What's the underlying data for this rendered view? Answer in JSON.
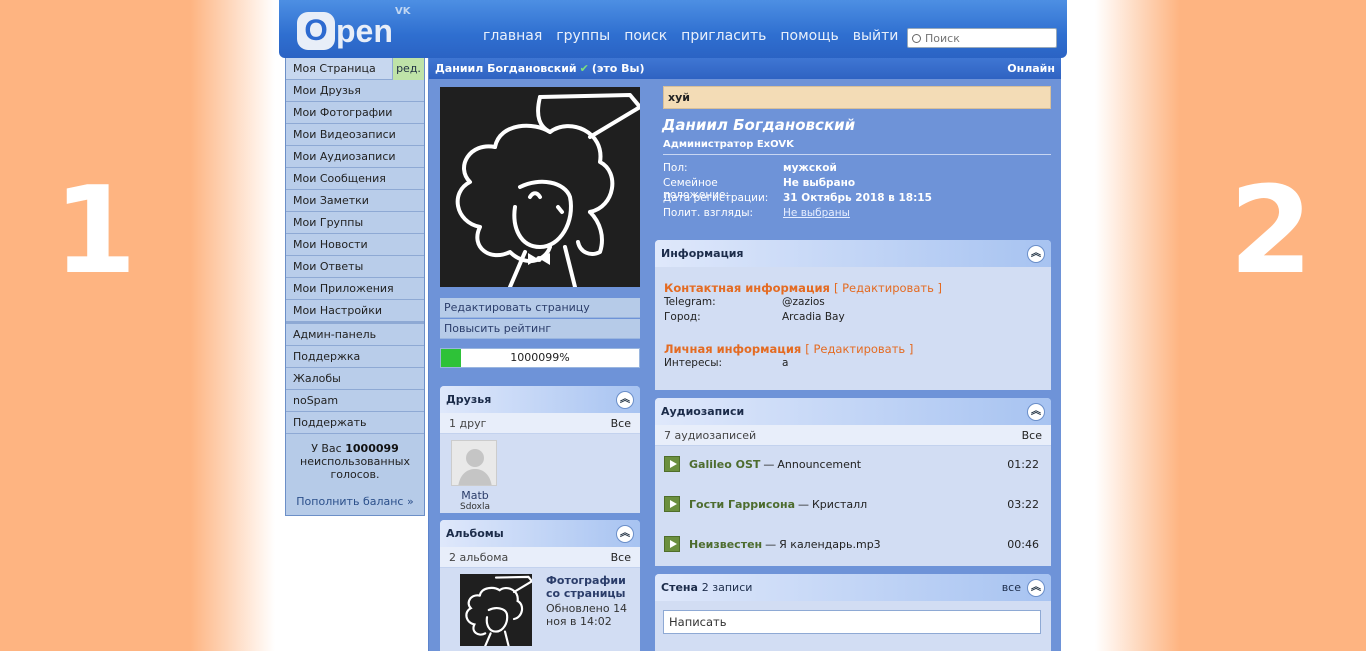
{
  "side_numbers": {
    "left": "1",
    "right": "2"
  },
  "header": {
    "logo_letter": "O",
    "logo_rest": "pen",
    "logo_sup": "VK",
    "nav": [
      "главная",
      "группы",
      "поиск",
      "пригласить",
      "помощь",
      "выйти"
    ],
    "search_placeholder": "Поиск"
  },
  "leftmenu": {
    "items": [
      "Моя Страница",
      "Мои Друзья",
      "Мои Фотографии",
      "Мои Видеозаписи",
      "Мои Аудиозаписи",
      "Мои Сообщения",
      "Мои Заметки",
      "Мои Группы",
      "Мои Новости",
      "Мои Ответы",
      "Мои Приложения",
      "Мои Настройки"
    ],
    "edit_label": "ред.",
    "admin_items": [
      "Админ-панель",
      "Поддержка",
      "Жалобы",
      "noSpam",
      "Поддержать"
    ],
    "votes_prefix": "У Вас",
    "votes_count": "1000099",
    "votes_suffix": "неиспользованных голосов.",
    "topup": "Пополнить баланс »"
  },
  "profile": {
    "title_name": "Даниил Богдановский",
    "title_you": "(это Вы)",
    "online": "Онлайн",
    "edit_page": "Редактировать страницу",
    "boost_rating": "Повысить рейтинг",
    "rating_text": "1000099%",
    "rating_fill": 0.1,
    "status": "хуй",
    "name": "Даниил Богдановский",
    "role": "Администратор ExOVK",
    "fields": [
      {
        "k": "Пол:",
        "v": "мужской"
      },
      {
        "k": "Семейное положение:",
        "v": "Не выбрано"
      },
      {
        "k": "Дата регистрации:",
        "v": "31 Октябрь 2018 в 18:15"
      },
      {
        "k": "Полит. взгляды:",
        "v": "Не выбраны"
      }
    ]
  },
  "friends": {
    "title": "Друзья",
    "count": "1 друг",
    "all": "Все",
    "items": [
      {
        "name": "Matb",
        "sub": "Sdoxla"
      }
    ]
  },
  "albums": {
    "title": "Альбомы",
    "count": "2 альбома",
    "all": "Все",
    "items": [
      {
        "title": "Фотографии со страницы",
        "date": "Обновлено 14 ноя в 14:02"
      }
    ]
  },
  "info": {
    "title": "Информация",
    "contact_title": "Контактная информация",
    "edit": "[ Редактировать ]",
    "contact": [
      {
        "k": "Telegram:",
        "v": "@zazios"
      },
      {
        "k": "Город:",
        "v": "Arcadia Bay"
      }
    ],
    "personal_title": "Личная информация",
    "personal": [
      {
        "k": "Интересы:",
        "v": "a"
      }
    ]
  },
  "audio": {
    "title": "Аудиозаписи",
    "count": "7 аудиозаписей",
    "all": "Все",
    "tracks": [
      {
        "artist": "Galileo OST",
        "title": "Announcement",
        "duration": "01:22"
      },
      {
        "artist": "Гости Гаррисона",
        "title": "Кристалл",
        "duration": "03:22"
      },
      {
        "artist": "Неизвестен",
        "title": "Я календарь.mp3",
        "duration": "00:46"
      }
    ]
  },
  "wall": {
    "title": "Стена",
    "count": "2 записи",
    "all": "все",
    "placeholder": "Написать"
  }
}
